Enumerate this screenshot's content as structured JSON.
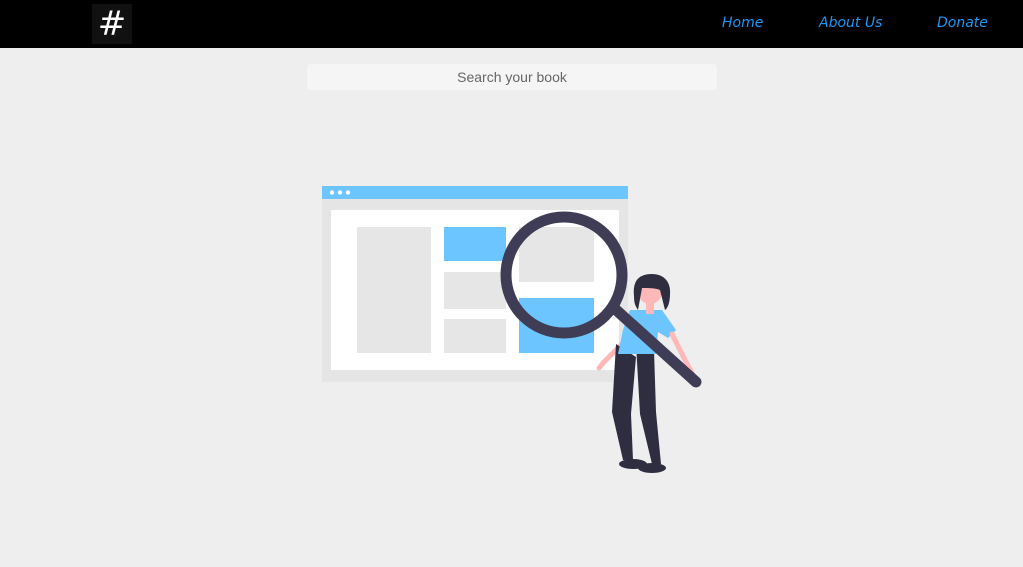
{
  "header": {
    "logo_symbol": "#",
    "nav": {
      "home": "Home",
      "about": "About Us",
      "donate": "Donate"
    },
    "nav_color": "#2196f3"
  },
  "search": {
    "placeholder": "Search your book",
    "value": ""
  },
  "illustration": {
    "name": "person-searching-website-illustration",
    "accent_color": "#6cc5ff"
  }
}
